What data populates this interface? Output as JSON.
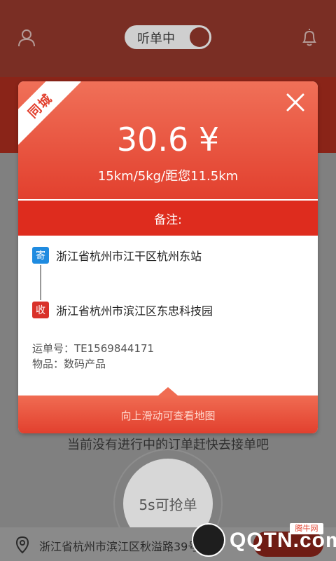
{
  "header": {
    "listening_label": "听单中"
  },
  "background": {
    "empty_tip": "当前没有进行中的订单赶快去接单吧",
    "grab_button_label": "5s可抢单",
    "location_text": "浙江省杭州市滨江区秋溢路39号"
  },
  "order": {
    "tag": "同城",
    "price": "30.6 ¥",
    "summary": "15km/5kg/距您11.5km",
    "note_label": "备注:",
    "sender": {
      "badge": "寄",
      "address": "浙江省杭州市江干区杭州东站"
    },
    "receiver": {
      "badge": "收",
      "address": "浙江省杭州市滨江区东忠科技园"
    },
    "waybill": "运单号：TE1569844171",
    "goods": "物品：数码产品",
    "swipe_hint": "向上滑动可查看地图"
  },
  "watermark": {
    "brand": "QQTN.com",
    "tag": "腾牛网"
  },
  "colors": {
    "accent_red": "#e2402e",
    "send_blue": "#1f8be0",
    "recv_red": "#d9322a"
  }
}
